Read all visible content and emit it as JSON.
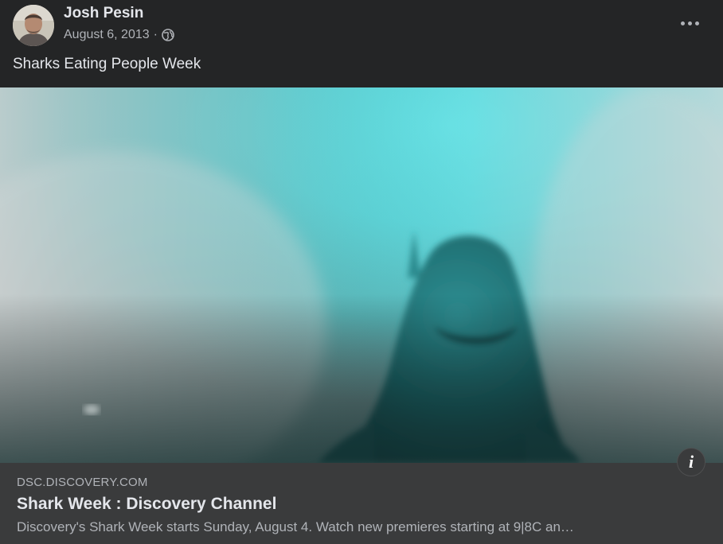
{
  "post": {
    "author": "Josh Pesin",
    "date": "August 6, 2013",
    "separator": "·",
    "privacy_icon": "globe-icon",
    "more_icon": "more-options-icon",
    "text": "Sharks Eating People Week"
  },
  "link_preview": {
    "domain": "DSC.DISCOVERY.COM",
    "title": "Shark Week : Discovery Channel",
    "description": "Discovery's Shark Week starts Sunday, August 4. Watch new premieres starting at 9|8C an…",
    "info_icon": "info-icon",
    "info_label": "i"
  },
  "colors": {
    "background": "#242526",
    "card": "#3a3b3c",
    "primary_text": "#e4e6eb",
    "secondary_text": "#b0b3b8",
    "water_cyan": "#2fe8ee"
  }
}
